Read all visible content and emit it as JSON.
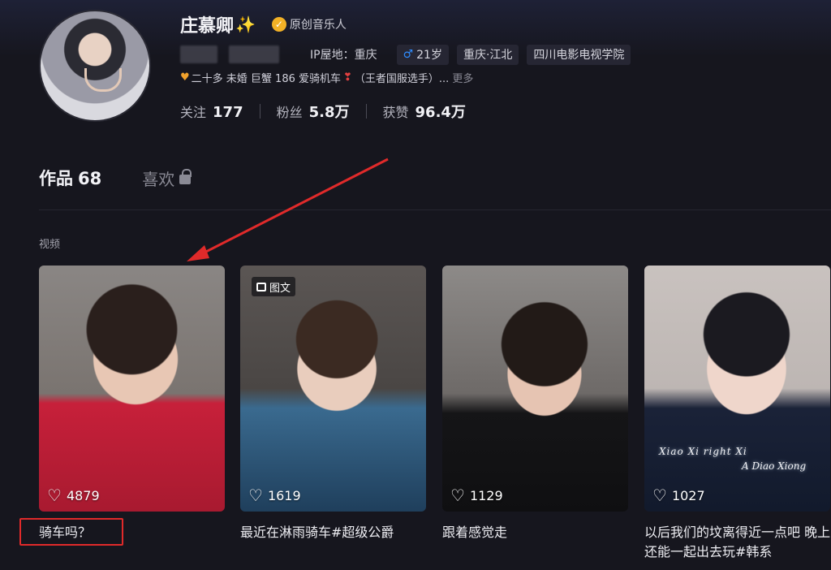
{
  "profile": {
    "name": "庄慕卿",
    "name_emoji": "✨",
    "verified_icon": "verified-check-icon",
    "verified_label": "原创音乐人",
    "ip_location": "IP屋地：重庆",
    "tags": [
      "21岁",
      "重庆·江北",
      "四川电影电视学院"
    ],
    "gender_icon": "male-icon",
    "bio": "二十多 未婚 巨蟹 186 爱骑机车",
    "bio_tail": "（王者国服选手）...",
    "bio_more": "更多"
  },
  "stats": [
    {
      "label": "关注",
      "value": "177"
    },
    {
      "label": "粉丝",
      "value": "5.8万"
    },
    {
      "label": "获赞",
      "value": "96.4万"
    }
  ],
  "tabs": {
    "works_label": "作品",
    "works_count": "68",
    "likes_label": "喜欢"
  },
  "section_label": "视频",
  "image_post_badge": "图文",
  "watermark_text_1": "Xiao Xi right Xi",
  "watermark_text_2": "A Diao Xiong",
  "videos": [
    {
      "likes": "4879",
      "caption": "骑车吗？"
    },
    {
      "likes": "1619",
      "caption": "最近在淋雨骑车#超级公爵"
    },
    {
      "likes": "1129",
      "caption": "跟着感觉走"
    },
    {
      "likes": "1027",
      "caption": "以后我们的坟离得近一点吧 晚上还能一起出去玩#韩系"
    }
  ],
  "colors": {
    "background": "#16161e",
    "annotation_red": "#e02a2a",
    "verified": "#f2b126",
    "male_blue": "#2f8cff"
  }
}
